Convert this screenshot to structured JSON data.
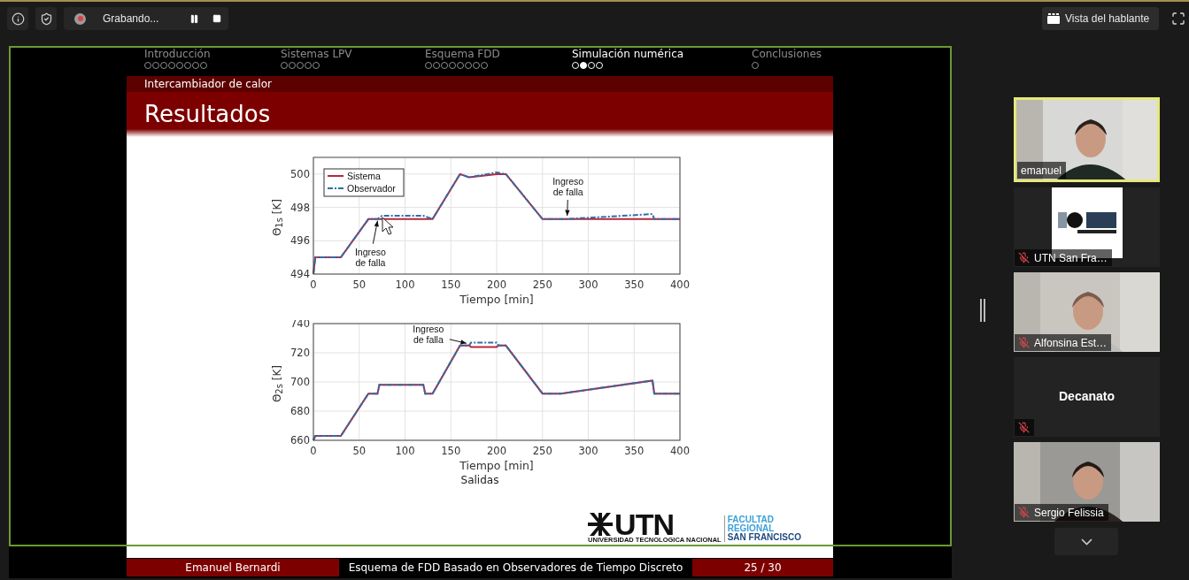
{
  "toolbar": {
    "recording": {
      "label": "Grabando..."
    },
    "view_button": {
      "label": "Vista del hablante"
    }
  },
  "slide": {
    "sections": [
      {
        "title": "Introducción",
        "selected": false,
        "frames": [
          {
            "selected": false
          },
          {
            "selected": false
          },
          {
            "selected": false
          },
          {
            "selected": false
          },
          {
            "selected": false
          },
          {
            "selected": false
          },
          {
            "selected": false
          },
          {
            "selected": false
          }
        ]
      },
      {
        "title": "Sistemas LPV",
        "selected": false,
        "frames": [
          {
            "selected": false
          },
          {
            "selected": false
          },
          {
            "selected": false
          },
          {
            "selected": false
          },
          {
            "selected": false
          }
        ]
      },
      {
        "title": "Esquema FDD",
        "selected": false,
        "frames": [
          {
            "selected": false
          },
          {
            "selected": false
          },
          {
            "selected": false
          },
          {
            "selected": false
          },
          {
            "selected": false
          },
          {
            "selected": false
          },
          {
            "selected": false
          },
          {
            "selected": false
          }
        ]
      },
      {
        "title": "Simulación numérica",
        "selected": true,
        "frames": [
          {
            "selected": false
          },
          {
            "selected": true
          },
          {
            "selected": false
          },
          {
            "selected": false
          }
        ]
      },
      {
        "title": "Conclusiones",
        "selected": false,
        "frames": [
          {
            "selected": false
          }
        ]
      }
    ],
    "subsection": "Intercambiador de calor",
    "title": "Resultados",
    "figures": [
      {
        "chart_data": {
          "type": "line",
          "xlabel": "Tiempo [min]",
          "ylabel": "Θ$_{1s}$ [K]",
          "legend": true,
          "grid": true,
          "x": [
            0,
            2,
            30,
            60,
            70,
            75,
            120,
            130,
            160,
            170,
            200,
            210,
            250,
            275,
            370,
            372,
            400
          ],
          "series": [
            {
              "name": "Sistema",
              "color": "#b5283c",
              "line_style": "solid",
              "values": [
                494,
                495,
                495,
                497.3,
                497.3,
                497.3,
                497.3,
                497.3,
                500,
                499.8,
                500,
                500,
                497.3,
                497.3,
                497.3,
                497.3,
                497.3
              ]
            },
            {
              "name": "Observador",
              "color": "#2f6ea8",
              "line_style": "dashdot",
              "values": [
                494,
                495,
                495,
                497.3,
                497.3,
                497.5,
                497.5,
                497.3,
                500,
                499.8,
                500.1,
                500,
                497.3,
                497.3,
                497.6,
                497.3,
                497.3
              ]
            }
          ],
          "xlim": [
            0,
            400
          ],
          "ylim": [
            494,
            501
          ],
          "xticks": [
            0,
            50,
            100,
            150,
            200,
            250,
            300,
            350,
            400
          ],
          "yticks": [
            494,
            496,
            498,
            500
          ],
          "annotations": [
            {
              "text": "Ingreso de falla",
              "x": 70,
              "y": 497.2
            },
            {
              "text": "Ingreso de falla",
              "x": 277,
              "y": 497.5
            }
          ]
        }
      },
      {
        "chart_data": {
          "type": "line",
          "xlabel": "Tiempo [min]",
          "ylabel": "Θ$_{2s}$ [K]",
          "grid": true,
          "x": [
            0,
            2,
            30,
            60,
            70,
            72,
            120,
            122,
            130,
            160,
            170,
            172,
            200,
            202,
            210,
            250,
            270,
            370,
            372,
            400
          ],
          "series": [
            {
              "color": "#b5283c",
              "line_style": "solid",
              "values": [
                660,
                663,
                663,
                692,
                692,
                698,
                698,
                692,
                692,
                725,
                725,
                724,
                724,
                725,
                725,
                692,
                692,
                701,
                692,
                692
              ]
            },
            {
              "color": "#2f6ea8",
              "line_style": "dashdot",
              "values": [
                660,
                663,
                663,
                692,
                692,
                698,
                698,
                692,
                692,
                725,
                725,
                727,
                727,
                725,
                725,
                692,
                692,
                701,
                692,
                692
              ]
            }
          ],
          "xlim": [
            0,
            400
          ],
          "ylim": [
            660,
            740
          ],
          "xticks": [
            0,
            50,
            100,
            150,
            200,
            250,
            300,
            350,
            400
          ],
          "yticks": [
            660,
            680,
            700,
            720,
            740
          ],
          "annotations": [
            {
              "text": "Ingreso de falla",
              "x": 167,
              "y": 726.5
            }
          ]
        }
      }
    ],
    "caption": "Salidas",
    "logo": {
      "wordmark": "UTN",
      "subtitle": "UNIVERSIDAD TECNOLOGICA NACIONAL",
      "lines": [
        "FACULTAD",
        "REGIONAL",
        "SAN FRANCISCO"
      ]
    },
    "footer": {
      "author": "Emanuel Bernardi",
      "talk_title": "Esquema de FDD Basado en Observadores de Tiempo Discreto",
      "page": "25 / 30"
    }
  },
  "participants": [
    {
      "name": "emanuel",
      "kind": "video",
      "muted": false,
      "active": true
    },
    {
      "name": "UTN San Fra…",
      "kind": "logo",
      "muted": true,
      "active": false
    },
    {
      "name": "Alfonsina Est…",
      "kind": "video",
      "muted": true,
      "active": false
    },
    {
      "name": "Decanato",
      "kind": "avatar",
      "muted": true,
      "active": false
    },
    {
      "name": "Sergio Felissia",
      "kind": "video",
      "muted": true,
      "active": false
    }
  ]
}
